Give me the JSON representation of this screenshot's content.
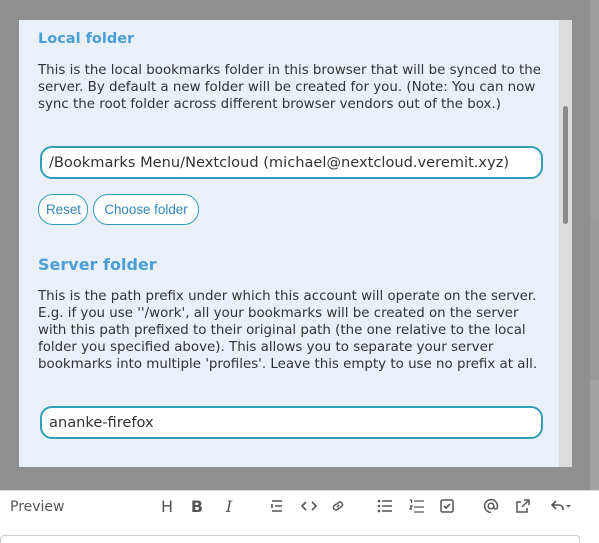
{
  "local_folder": {
    "heading": "Local folder",
    "description": "This is the local bookmarks folder in this browser that will be synced to the server. By default a new folder will be created for you. (Note: You can now sync the root folder across different browser vendors out of the box.)",
    "path_value": "/Bookmarks Menu/Nextcloud (michael@nextcloud.veremit.xyz)",
    "reset_label": "Reset",
    "choose_label": "Choose folder"
  },
  "server_folder": {
    "heading": "Server folder",
    "description": "This is the path prefix under which this account will operate on the server. E.g. if you use ''/work', all your bookmarks will be created on the server with this path prefixed to their original path (the one relative to the local folder you specified above). This allows you to separate your server bookmarks into multiple 'profiles'. Leave this empty to use no prefix at all.",
    "path_value": "ananke-firefox"
  },
  "editor": {
    "preview_label": "Preview",
    "heading_glyph": "H",
    "bold_glyph": "B",
    "italic_glyph": "I"
  },
  "icons": [
    "heading-icon",
    "bold-icon",
    "italic-icon",
    "blockquote-icon",
    "code-icon",
    "link-icon",
    "bullet-list-icon",
    "numbered-list-icon",
    "checklist-icon",
    "mention-icon",
    "open-link-icon",
    "undo-icon"
  ],
  "colors": {
    "accent": "#4a9fd6",
    "border": "#2f9fb5",
    "modal_bg": "#e9f0f8"
  }
}
